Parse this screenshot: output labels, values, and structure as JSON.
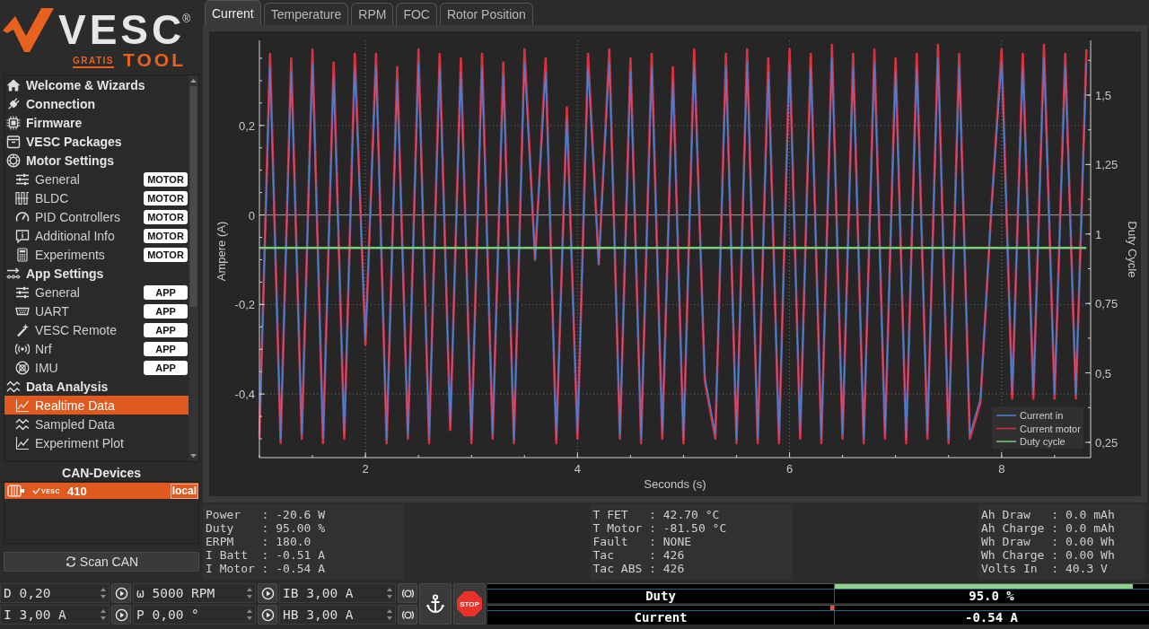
{
  "logo": {
    "name": "VESC",
    "mark": "®",
    "edition": "GRATIS",
    "product": "TOOL"
  },
  "sidebar": {
    "items": [
      {
        "label": "Welcome & Wizards",
        "selected": false
      },
      {
        "label": "Connection",
        "selected": false
      },
      {
        "label": "Firmware",
        "selected": false
      },
      {
        "label": "VESC Packages",
        "selected": false
      },
      {
        "label": "Motor Settings",
        "selected": false,
        "children": [
          {
            "label": "General",
            "badge": "MOTOR",
            "selected": false
          },
          {
            "label": "BLDC",
            "badge": "MOTOR",
            "selected": false
          },
          {
            "label": "PID Controllers",
            "badge": "MOTOR",
            "selected": false
          },
          {
            "label": "Additional Info",
            "badge": "MOTOR",
            "selected": false
          },
          {
            "label": "Experiments",
            "badge": "MOTOR",
            "selected": false
          }
        ]
      },
      {
        "label": "App Settings",
        "selected": false,
        "children": [
          {
            "label": "General",
            "badge": "APP",
            "selected": false
          },
          {
            "label": "UART",
            "badge": "APP",
            "selected": false
          },
          {
            "label": "VESC Remote",
            "badge": "APP",
            "selected": false
          },
          {
            "label": "Nrf",
            "badge": "APP",
            "selected": false
          },
          {
            "label": "IMU",
            "badge": "APP",
            "selected": false
          }
        ]
      },
      {
        "label": "Data Analysis",
        "selected": false,
        "children": [
          {
            "label": "Realtime Data",
            "selected": true
          },
          {
            "label": "Sampled Data",
            "selected": false
          },
          {
            "label": "Experiment Plot",
            "selected": false
          }
        ]
      }
    ]
  },
  "can_devices": {
    "title": "CAN-Devices",
    "devices": [
      {
        "brand": "VESC",
        "id": "410",
        "tag": "local",
        "selected": true
      }
    ],
    "scan_button": "Scan CAN"
  },
  "tabs": [
    {
      "label": "Current",
      "selected": true
    },
    {
      "label": "Temperature",
      "selected": false
    },
    {
      "label": "RPM",
      "selected": false
    },
    {
      "label": "FOC",
      "selected": false
    },
    {
      "label": "Rotor Position",
      "selected": false
    }
  ],
  "chart": {
    "chart_data": {
      "type": "line",
      "xlabel": "Seconds (s)",
      "ylabel": "Ampere (A)",
      "y2label": "Duty Cycle",
      "grid": true,
      "legend": "lower right",
      "xlim": [
        1.0,
        8.84
      ],
      "ylim": [
        -0.542,
        0.39
      ],
      "y2lim": [
        0.195,
        1.697
      ],
      "xticks": [
        2,
        4,
        6,
        8
      ],
      "yticks": [
        {
          "value": 0.2,
          "label": "0,2"
        },
        {
          "value": 0,
          "label": "0"
        },
        {
          "value": -0.2,
          "label": "-0,2"
        },
        {
          "value": -0.4,
          "label": "-0,4"
        }
      ],
      "y2ticks": [
        {
          "value": 0.25,
          "label": "0,25"
        },
        {
          "value": 0.5,
          "label": "0,5"
        },
        {
          "value": 0.75,
          "label": "0,75"
        },
        {
          "value": 1,
          "label": "1"
        },
        {
          "value": 1.25,
          "label": "1,25"
        },
        {
          "value": 1.5,
          "label": "1,5"
        }
      ],
      "x": [
        1,
        1.1,
        1.2,
        1.3,
        1.4,
        1.5,
        1.6,
        1.7,
        1.8,
        1.9,
        2,
        2.1,
        2.2,
        2.3,
        2.4,
        2.5,
        2.6,
        2.7,
        2.8,
        2.9,
        3,
        3.1,
        3.2,
        3.3,
        3.4,
        3.5,
        3.6,
        3.7,
        3.8,
        3.9,
        4,
        4.1,
        4.2,
        4.3,
        4.4,
        4.5,
        4.6,
        4.7,
        4.8,
        4.9,
        5,
        5.1,
        5.2,
        5.3,
        5.4,
        5.5,
        5.6,
        5.7,
        5.8,
        5.9,
        6,
        6.1,
        6.2,
        6.3,
        6.4,
        6.5,
        6.6,
        6.7,
        6.8,
        6.9,
        7,
        7.1,
        7.2,
        7.3,
        7.4,
        7.5,
        7.6,
        7.7,
        7.8,
        7.9,
        8,
        8.1,
        8.2,
        8.3,
        8.4,
        8.5,
        8.6,
        8.7,
        8.8
      ],
      "series": [
        {
          "name": "Current in",
          "color": "#4f7fd6",
          "values": [
            -0.49,
            0.33,
            -0.5,
            0.32,
            -0.49,
            0.34,
            -0.5,
            0.31,
            -0.49,
            0.33,
            -0.28,
            0.33,
            -0.5,
            0.3,
            -0.49,
            0.34,
            -0.5,
            0.33,
            -0.47,
            0.32,
            -0.5,
            0.33,
            -0.49,
            0.31,
            -0.5,
            0.34,
            -0.1,
            0.32,
            -0.5,
            0.22,
            -0.49,
            0.33,
            -0.11,
            0.34,
            -0.49,
            0.32,
            -0.5,
            0.33,
            -0.49,
            0.3,
            -0.5,
            0.34,
            -0.36,
            -0.49,
            0.33,
            -0.5,
            0.34,
            -0.5,
            0.32,
            -0.5,
            0.34,
            -0.49,
            0.33,
            -0.5,
            0.35,
            -0.49,
            0.33,
            -0.5,
            0.34,
            -0.49,
            0.32,
            -0.5,
            0.33,
            -0.49,
            0.35,
            -0.5,
            0.33,
            -0.49,
            -0.41,
            0.0,
            0.34,
            -0.4,
            0.33,
            -0.4,
            0.35,
            -0.4,
            0.33,
            -0.4,
            0.34
          ]
        },
        {
          "name": "Current motor",
          "color": "#d8313f",
          "values": [
            -0.5,
            0.36,
            -0.51,
            0.35,
            -0.5,
            0.37,
            -0.51,
            0.34,
            -0.5,
            0.36,
            -0.29,
            0.36,
            -0.51,
            0.33,
            -0.5,
            0.37,
            -0.51,
            0.36,
            -0.48,
            0.35,
            -0.51,
            0.36,
            -0.5,
            0.34,
            -0.51,
            0.37,
            -0.1,
            0.35,
            -0.51,
            0.24,
            -0.5,
            0.36,
            -0.11,
            0.37,
            -0.5,
            0.35,
            -0.51,
            0.36,
            -0.5,
            0.33,
            -0.51,
            0.37,
            -0.37,
            -0.5,
            0.36,
            -0.51,
            0.37,
            -0.51,
            0.35,
            -0.51,
            0.37,
            -0.5,
            0.36,
            -0.51,
            0.38,
            -0.5,
            0.36,
            -0.51,
            0.37,
            -0.5,
            0.35,
            -0.51,
            0.36,
            -0.5,
            0.38,
            -0.51,
            0.36,
            -0.5,
            -0.42,
            0.0,
            0.37,
            -0.41,
            0.36,
            -0.41,
            0.38,
            -0.41,
            0.36,
            -0.41,
            0.37
          ]
        },
        {
          "name": "Duty cycle",
          "color": "#7dcc7d",
          "axis": "y2",
          "values": [
            0.95,
            0.95,
            0.95,
            0.95,
            0.95,
            0.95,
            0.95,
            0.95,
            0.95,
            0.95,
            0.95,
            0.95,
            0.95,
            0.95,
            0.95,
            0.95,
            0.95,
            0.95,
            0.95,
            0.95,
            0.95,
            0.95,
            0.95,
            0.95,
            0.95,
            0.95,
            0.95,
            0.95,
            0.95,
            0.95,
            0.95,
            0.95,
            0.95,
            0.95,
            0.95,
            0.95,
            0.95,
            0.95,
            0.95,
            0.95,
            0.95,
            0.95,
            0.95,
            0.95,
            0.95,
            0.95,
            0.95,
            0.95,
            0.95,
            0.95,
            0.95,
            0.95,
            0.95,
            0.95,
            0.95,
            0.95,
            0.95,
            0.95,
            0.95,
            0.95,
            0.95,
            0.95,
            0.95,
            0.95,
            0.95,
            0.95,
            0.95,
            0.95,
            0.95,
            0.95,
            0.95,
            0.95,
            0.95,
            0.95,
            0.95,
            0.95,
            0.95,
            0.95,
            0.95
          ]
        }
      ]
    }
  },
  "readouts": [
    {
      "lines": [
        "Power   : -20.6 W",
        "Duty    : 95.00 %",
        "ERPM    : 180.0",
        "I Batt  : -0.51 A",
        "I Motor : -0.54 A"
      ]
    },
    {
      "lines": [
        "T FET   : 42.70 °C",
        "T Motor : -81.50 °C",
        "Fault   : NONE",
        "Tac     : 426",
        "Tac ABS : 426"
      ]
    },
    {
      "lines": [
        "Ah Draw   : 0.0 mAh",
        "Ah Charge : 0.0 mAh",
        "Wh Draw   : 0.00 Wh",
        "Wh Charge : 0.00 Wh",
        "Volts In  : 40.3 V"
      ]
    }
  ],
  "controls": {
    "rows": [
      {
        "fields": [
          {
            "value": "D 0,20"
          },
          {
            "value": "ω 5000 RPM"
          },
          {
            "value": "IB 3,00 A"
          }
        ]
      },
      {
        "fields": [
          {
            "value": "I 3,00 A"
          },
          {
            "value": "P 0,00 °"
          },
          {
            "value": "HB 3,00 A"
          }
        ]
      }
    ],
    "stop_button": "STOP"
  },
  "gauges": [
    {
      "label": "Duty",
      "value": "95.0 %",
      "level": 0.975,
      "color": "#8fd18f"
    },
    {
      "label": "Current",
      "value": "-0.54 A",
      "level": 0.495,
      "color": "#e05050"
    }
  ]
}
